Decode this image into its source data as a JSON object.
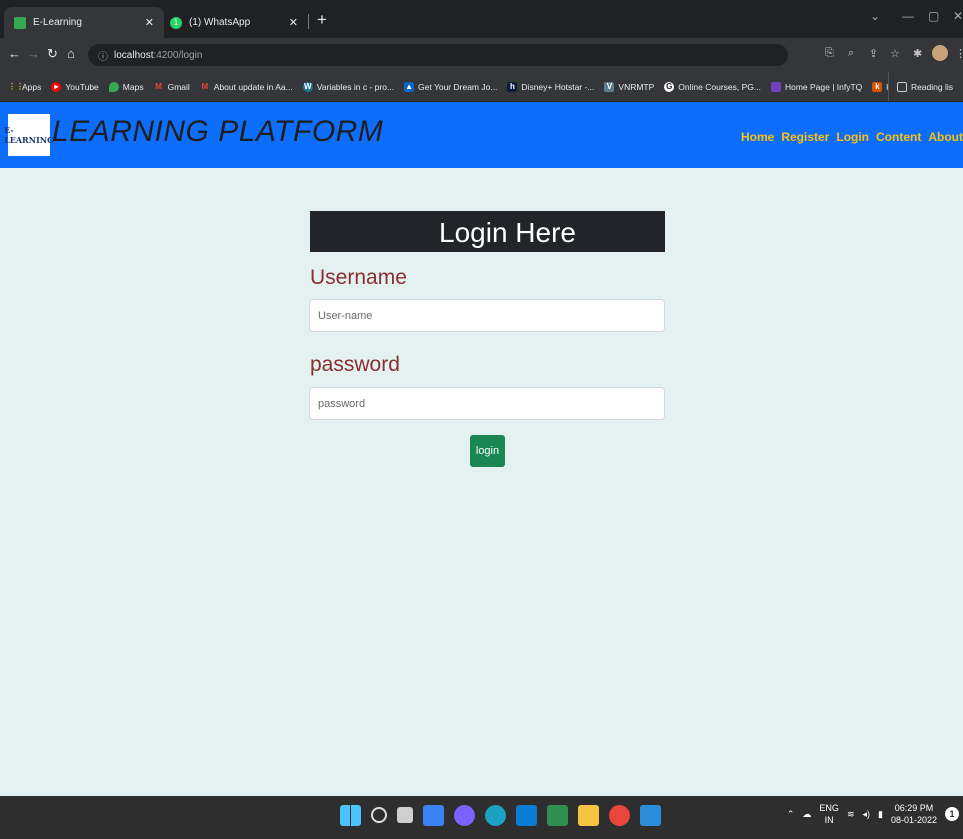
{
  "browser": {
    "tabs": [
      {
        "title": "E-Learning",
        "favicon_color": "#34a853",
        "active": true
      },
      {
        "title": "(1) WhatsApp",
        "favicon_color": "#25d366",
        "favicon_text": "1",
        "active": false
      }
    ],
    "new_tab_label": "+",
    "url_host": "localhost",
    "url_path": ":4200/login",
    "bookmarks": [
      {
        "label": "Apps",
        "color": "#fbbc04",
        "icon": "apps-grid-icon"
      },
      {
        "label": "YouTube",
        "color": "#ff0000",
        "icon": "youtube-icon"
      },
      {
        "label": "Maps",
        "color": "#34a853",
        "icon": "maps-icon"
      },
      {
        "label": "Gmail",
        "color": "#ea4335",
        "icon": "gmail-icon"
      },
      {
        "label": "About update in Aa...",
        "color": "#ea4335",
        "icon": "gmail-icon"
      },
      {
        "label": "Variables in c - pro...",
        "color": "#21759b",
        "icon": "wordpress-icon"
      },
      {
        "label": "Get Your Dream Jo...",
        "color": "#0a66c2",
        "icon": "job-icon"
      },
      {
        "label": "Disney+ Hotstar -...",
        "color": "#0c1c3c",
        "icon": "hotstar-icon"
      },
      {
        "label": "VNRMTP",
        "color": "#607d8b",
        "icon": "vnr-icon"
      },
      {
        "label": "Online Courses, PG...",
        "color": "#444444",
        "icon": "courses-icon"
      },
      {
        "label": "Home Page | InfyTQ",
        "color": "#6f42c1",
        "icon": "infytq-icon"
      },
      {
        "label": "kashipara",
        "color": "#d35400",
        "icon": "kashipara-icon"
      }
    ],
    "reading_list": "Reading lis"
  },
  "app": {
    "logo_text": "E-LEARNING",
    "brand": "LEARNING PLATFORM",
    "nav": [
      "Home",
      "Register",
      "Login",
      "Content",
      "About"
    ],
    "accent_color": "#0d6efd",
    "nav_link_color": "#ffc107"
  },
  "login": {
    "title": "Login Here",
    "username_label": "Username",
    "username_placeholder": "User-name",
    "password_label": "password",
    "password_placeholder": "password",
    "button_label": "login"
  },
  "taskbar": {
    "language": "ENG",
    "region": "IN",
    "time": "06:29 PM",
    "date": "08-01-2022",
    "notifications": "1"
  }
}
